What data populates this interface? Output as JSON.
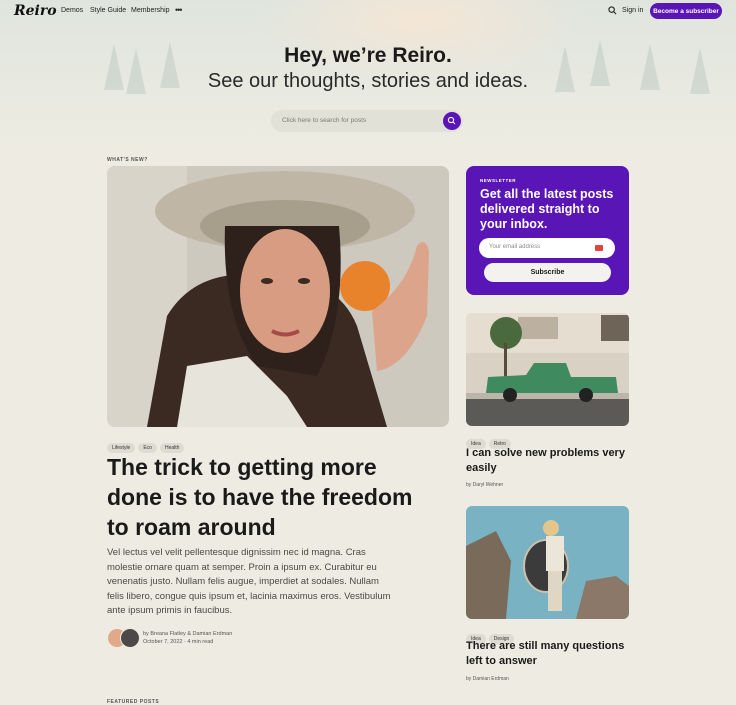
{
  "nav": {
    "logo": "Reiro",
    "links": [
      "Demos",
      "Style Guide",
      "Membership"
    ],
    "more": "•••",
    "signin": "Sign in",
    "cta": "Become a subscriber"
  },
  "hero": {
    "title": "Hey, we’re Reiro.",
    "subtitle": "See our thoughts, stories and ideas.",
    "search_placeholder": "Click here to search for posts"
  },
  "sections": {
    "whats_new": "WHAT'S NEW?",
    "featured": "FEATURED POSTS"
  },
  "featured_post": {
    "tags": [
      "Lifestyle",
      "Eco",
      "Health"
    ],
    "title": "The trick to getting more done is to have the freedom to roam around",
    "excerpt": "Vel lectus vel velit pellentesque dignissim nec id magna. Cras molestie ornare quam at semper. Proin a ipsum ex. Curabitur eu venenatis justo. Nullam felis augue, imperdiet at sodales. Nullam felis libero, congue quis ipsum et, lacinia maximus eros. Vestibulum ante ipsum primis in faucibus.",
    "authors": "by Breana Flatley & Damian Erdman",
    "meta": "October 7, 2022 · 4 min read"
  },
  "newsletter": {
    "label": "NEWSLETTER",
    "title": "Get all the latest posts delivered straight to your inbox.",
    "email_placeholder": "Your email address",
    "button": "Subscribe"
  },
  "side_posts": [
    {
      "tags": [
        "Idea",
        "Retro"
      ],
      "title": "I can solve new problems very easily",
      "author": "by Daryl Wehner"
    },
    {
      "tags": [
        "Idea",
        "Design"
      ],
      "title": "There are still many questions left to answer",
      "author": "by Damian Erdman"
    }
  ],
  "colors": {
    "accent": "#5a15b6",
    "background": "#eeece2"
  }
}
